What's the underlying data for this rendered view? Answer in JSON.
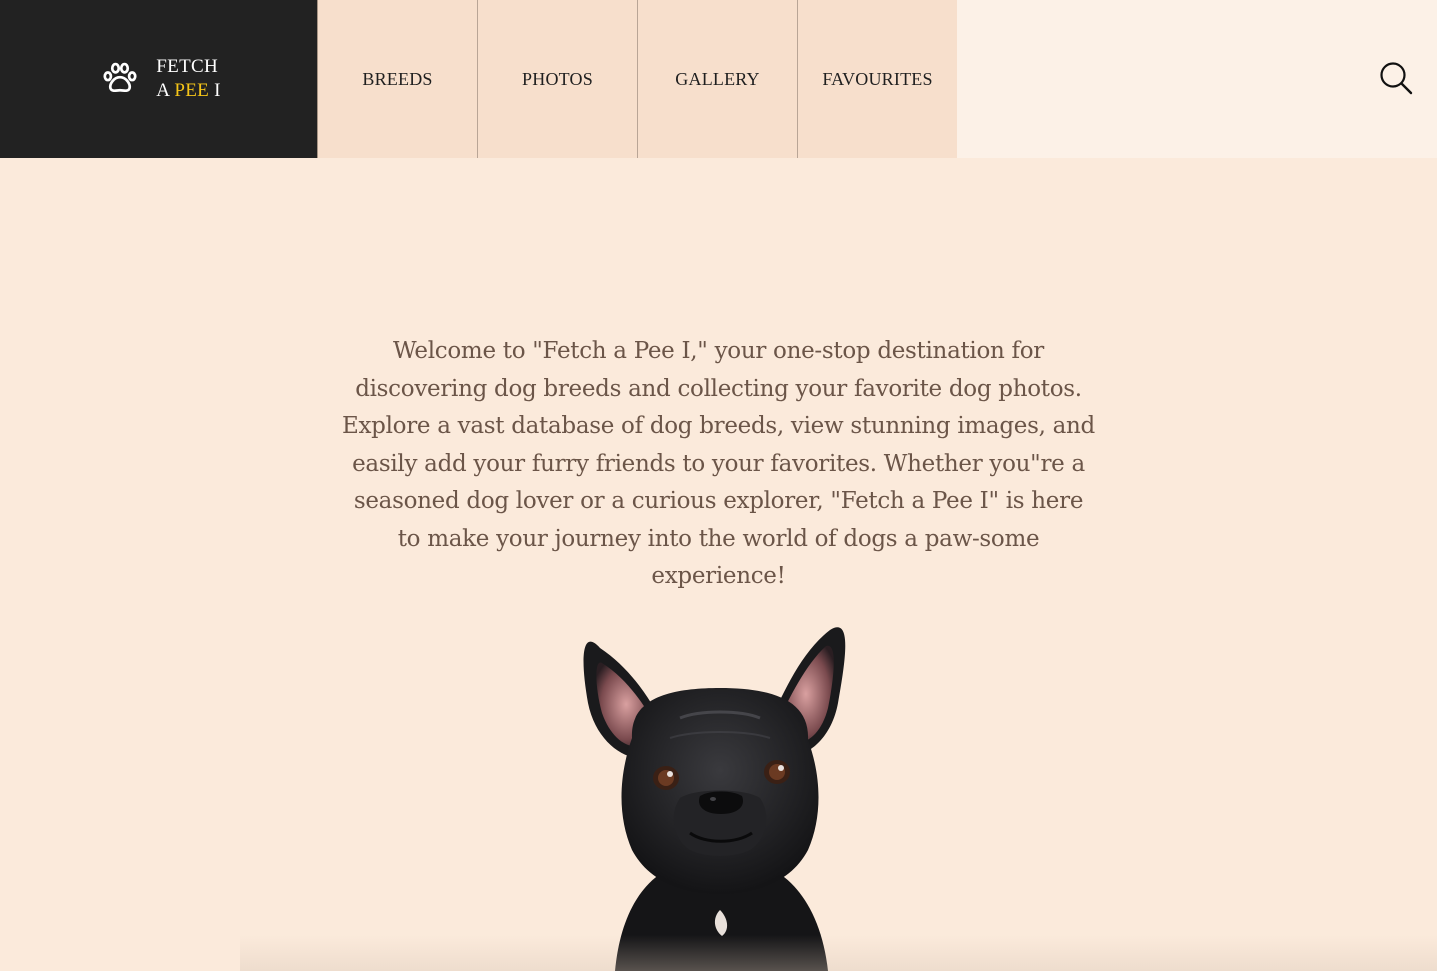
{
  "logo": {
    "line1": "FETCH",
    "line2_prefix": "A ",
    "line2_accent": "PEE",
    "line2_suffix": " I",
    "icon": "paw-icon",
    "accent_color": "#f5c518"
  },
  "nav": {
    "items": [
      {
        "label": "BREEDS"
      },
      {
        "label": "PHOTOS"
      },
      {
        "label": "GALLERY"
      },
      {
        "label": "FAVOURITES"
      }
    ],
    "search_icon": "search-icon"
  },
  "main": {
    "intro": "Welcome to \"Fetch a Pee I,\" your one-stop destination for discovering dog breeds and collecting your favorite dog photos. Explore a vast database of dog breeds, view stunning images, and easily add your furry friends to your favorites. Whether you\"re a seasoned dog lover or a curious explorer, \"Fetch a Pee I\" is here to make your journey into the world of dogs a paw-some experience!",
    "image": "french-bulldog-image"
  },
  "colors": {
    "logo_bg": "#222222",
    "nav_bg": "#f7dfcc",
    "header_bg": "#fcf1e7",
    "page_bg": "#fbeadb",
    "text": "#6b5548"
  }
}
